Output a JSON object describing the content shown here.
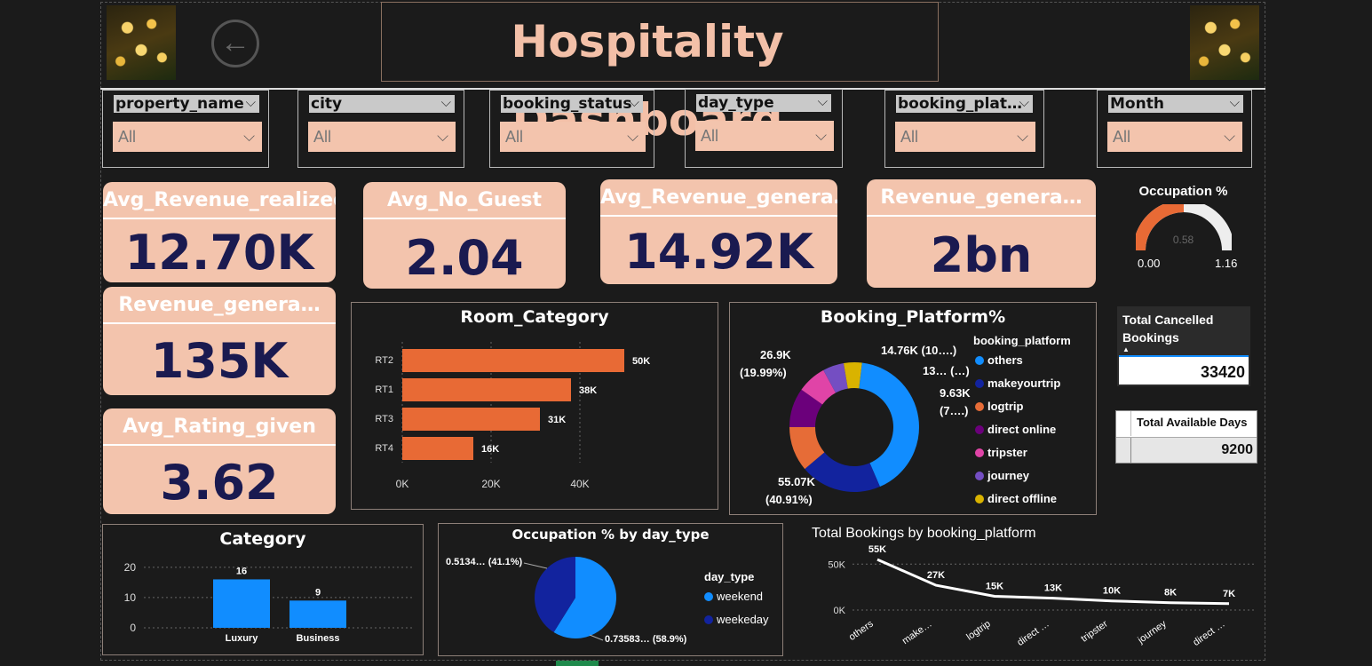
{
  "header": {
    "title": "Hospitality Dashboard",
    "back_icon": "arrow-left-circle"
  },
  "filters": [
    {
      "name": "property_name",
      "value": "All"
    },
    {
      "name": "city",
      "value": "All"
    },
    {
      "name": "booking_status",
      "value": "All"
    },
    {
      "name": "day_type",
      "value": "All"
    },
    {
      "name": "booking_plat…",
      "value": "All"
    },
    {
      "name": "Month",
      "value": "All"
    }
  ],
  "kpis": {
    "avg_revenue_realized": {
      "label": "Avg_Revenue_realized",
      "value": "12.70K"
    },
    "avg_no_guest": {
      "label": "Avg_No_Guest",
      "value": "2.04"
    },
    "avg_revenue_generated": {
      "label": "Avg_Revenue_genera…",
      "value": "14.92K"
    },
    "revenue_generated": {
      "label": "Revenue_genera…",
      "value": "2bn"
    },
    "revenue_generated_2": {
      "label": "Revenue_genera…",
      "value": "135K"
    },
    "avg_rating_given": {
      "label": "Avg_Rating_given",
      "value": "3.62"
    }
  },
  "gauge": {
    "title": "Occupation %",
    "value": 0.58,
    "value_label": "0.58",
    "min_label": "0.00",
    "max_label": "1.16"
  },
  "cancelled": {
    "header": "Total Cancelled Bookings",
    "value": "33420"
  },
  "available_days": {
    "header": "Total Available Days",
    "value": "9200"
  },
  "colors": {
    "orange": "#e86a35",
    "peach": "#f3c4ad",
    "navy": "#1a1a50",
    "blue": "#118dff",
    "darkblue": "#12239e"
  },
  "chart_data": [
    {
      "type": "bar",
      "orientation": "horizontal",
      "title": "Room_Category",
      "categories": [
        "RT2",
        "RT1",
        "RT3",
        "RT4"
      ],
      "values": [
        50000,
        38000,
        31000,
        16000
      ],
      "data_labels": [
        "50K",
        "38K",
        "31K",
        "16K"
      ],
      "x_ticks": [
        "0K",
        "20K",
        "40K"
      ],
      "xlim": [
        0,
        60000
      ]
    },
    {
      "type": "pie",
      "title": "Booking_Platform%",
      "legend_title": "booking_platform",
      "series": [
        {
          "name": "others",
          "value": 55.07,
          "color": "#118dff"
        },
        {
          "name": "makeyourtrip",
          "value": 26.9,
          "color": "#12239e"
        },
        {
          "name": "logtrip",
          "value": 14.76,
          "color": "#e66c37"
        },
        {
          "name": "direct online",
          "value": 13,
          "color": "#6b007b"
        },
        {
          "name": "tripster",
          "value": 9.63,
          "color": "#e044a7"
        },
        {
          "name": "journey",
          "value": 7,
          "color": "#744ec2"
        },
        {
          "name": "direct offline",
          "value": 6,
          "color": "#d9b300"
        }
      ],
      "data_labels": [
        "55.07K",
        "(40.91%)",
        "26.9K",
        "(19.99%)",
        "14.76K (10….)",
        "13… (…)",
        "9.63K",
        "(7….)"
      ]
    },
    {
      "type": "bar",
      "title": "Category",
      "categories": [
        "Luxury",
        "Business"
      ],
      "values": [
        16,
        9
      ],
      "y_ticks": [
        "0",
        "10",
        "20"
      ],
      "ylim": [
        0,
        22
      ]
    },
    {
      "type": "pie",
      "title": "Occupation % by day_type",
      "legend_title": "day_type",
      "series": [
        {
          "name": "weekend",
          "value": 0.73583,
          "color": "#118dff"
        },
        {
          "name": "weekeday",
          "value": 0.5134,
          "color": "#12239e"
        }
      ],
      "data_labels": [
        "0.5134… (41.1%)",
        "0.73583… (58.9%)"
      ]
    },
    {
      "type": "line",
      "title": "Total Bookings by booking_platform",
      "categories": [
        "others",
        "make…",
        "logtrip",
        "direct …",
        "tripster",
        "journey",
        "direct …"
      ],
      "values": [
        55000,
        27000,
        15000,
        13000,
        10000,
        8000,
        7000
      ],
      "data_labels": [
        "55K",
        "27K",
        "15K",
        "13K",
        "10K",
        "8K",
        "7K"
      ],
      "y_ticks": [
        "0K",
        "50K"
      ],
      "ylim": [
        0,
        58000
      ]
    }
  ]
}
